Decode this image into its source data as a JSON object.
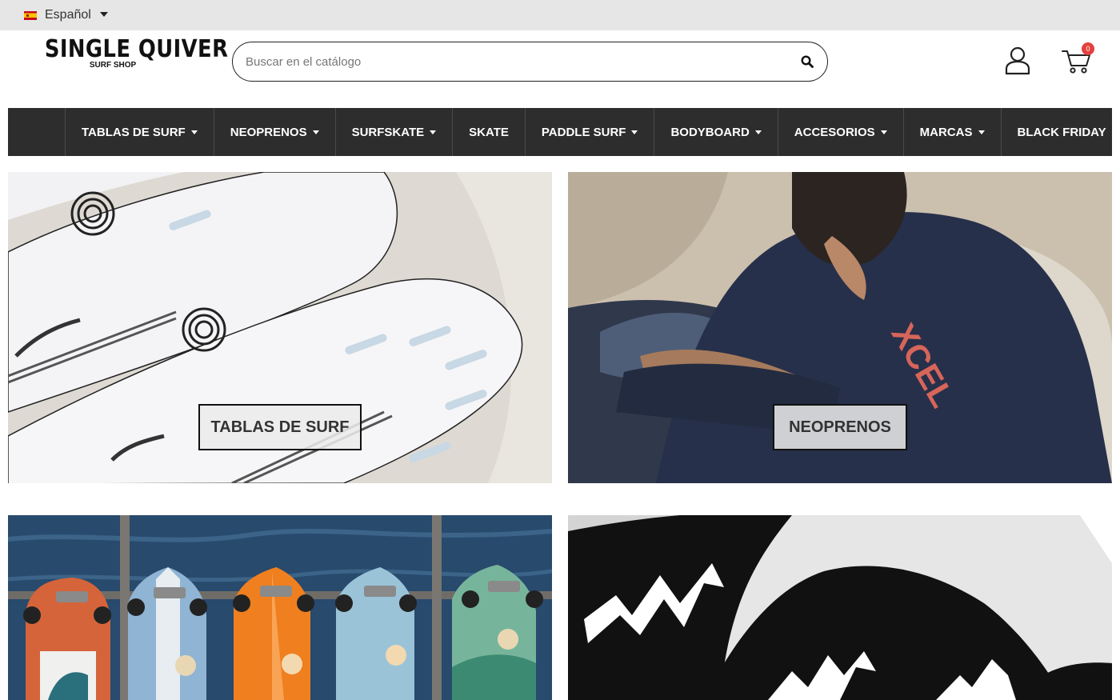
{
  "topbar": {
    "language": "Español"
  },
  "header": {
    "logo_main": "SINGLE QUIVER",
    "logo_sub": "SURF SHOP",
    "search_placeholder": "Buscar en el catálogo",
    "cart_count": "0"
  },
  "nav": {
    "items": [
      {
        "label": "TABLAS DE SURF",
        "has_dropdown": true
      },
      {
        "label": "NEOPRENOS",
        "has_dropdown": true
      },
      {
        "label": "SURFSKATE",
        "has_dropdown": true
      },
      {
        "label": "SKATE",
        "has_dropdown": false
      },
      {
        "label": "PADDLE SURF",
        "has_dropdown": true
      },
      {
        "label": "BODYBOARD",
        "has_dropdown": true
      },
      {
        "label": "ACCESORIOS",
        "has_dropdown": true
      },
      {
        "label": "MARCAS",
        "has_dropdown": true
      },
      {
        "label": "BLACK FRIDAY",
        "has_dropdown": false
      }
    ]
  },
  "tiles": {
    "surf_label": "TABLAS DE SURF",
    "neo_label": "NEOPRENOS"
  },
  "colors": {
    "nav_bg": "#2d2d2d",
    "topbar_bg": "#e6e6e6",
    "badge": "#e5403d"
  },
  "icons": [
    "flag-spain-icon",
    "chevron-down-icon",
    "search-icon",
    "user-icon",
    "cart-icon"
  ]
}
